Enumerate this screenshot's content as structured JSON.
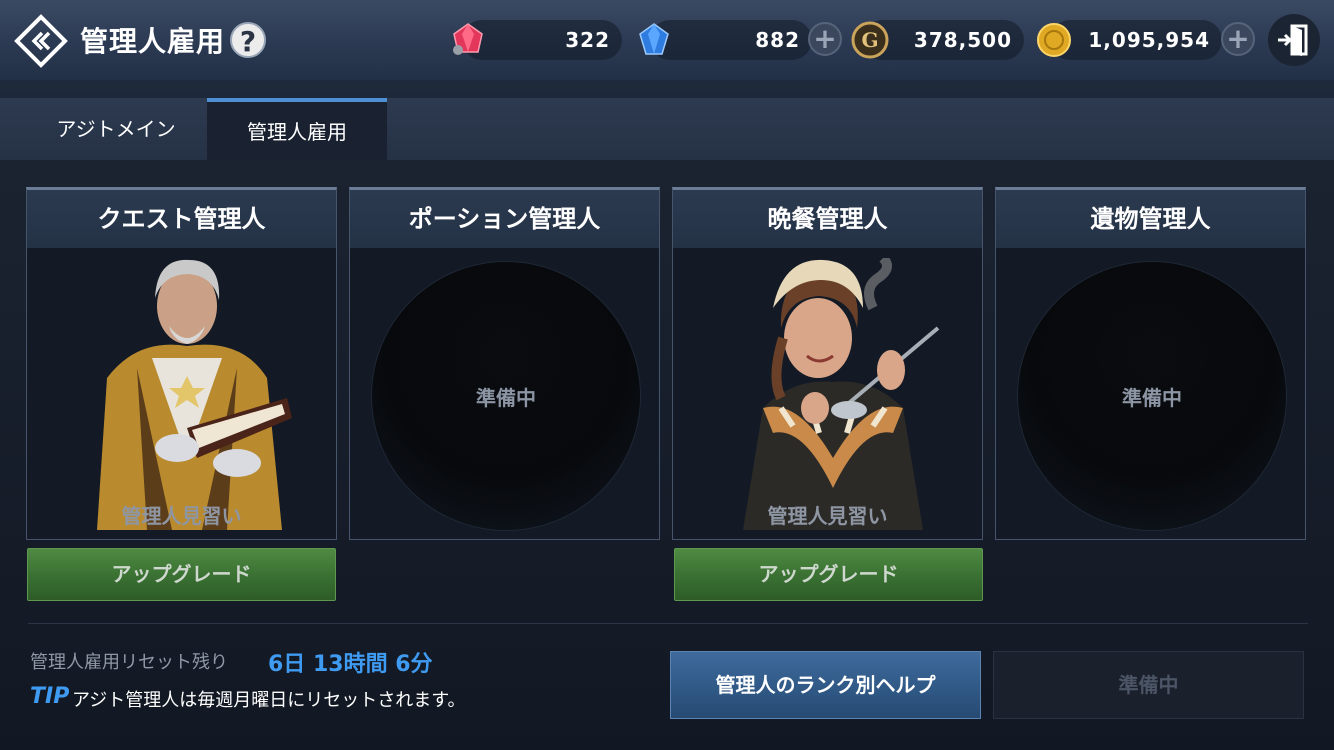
{
  "header": {
    "title": "管理人雇用",
    "help": "?",
    "currencies": {
      "ruby": "322",
      "sapphire": "882",
      "gold_g": "378,500",
      "coins": "1,095,954"
    }
  },
  "tabs": [
    {
      "label": "アジトメイン",
      "active": false
    },
    {
      "label": "管理人雇用",
      "active": true
    }
  ],
  "cards": [
    {
      "title": "クエスト管理人",
      "status": "hired",
      "rank_label": "管理人見習い",
      "upgrade_label": "アップグレード"
    },
    {
      "title": "ポーション管理人",
      "status": "pending",
      "pending_label": "準備中"
    },
    {
      "title": "晩餐管理人",
      "status": "hired",
      "rank_label": "管理人見習い",
      "upgrade_label": "アップグレード"
    },
    {
      "title": "遺物管理人",
      "status": "pending",
      "pending_label": "準備中"
    }
  ],
  "footer": {
    "reset_label": "管理人雇用リセット残り",
    "reset_time": "6日 13時間 6分",
    "tip_mark": "TIP",
    "tip_text": "アジト管理人は毎週月曜日にリセットされます。",
    "rank_help_button": "管理人のランク別ヘルプ",
    "pending_button": "準備中"
  },
  "colors": {
    "accent_blue": "#3f9bf2",
    "upgrade_green": "#3b7233",
    "help_button_blue": "#305986"
  }
}
